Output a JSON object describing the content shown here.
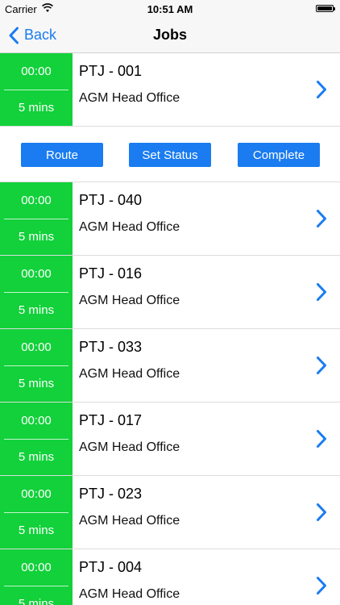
{
  "status_bar": {
    "carrier": "Carrier",
    "time": "10:51 AM"
  },
  "nav": {
    "back_label": "Back",
    "title": "Jobs"
  },
  "colors": {
    "accent": "#1a7cf0",
    "time_block": "#12d13a"
  },
  "actions": {
    "route": "Route",
    "set_status": "Set Status",
    "complete": "Complete"
  },
  "jobs": [
    {
      "time": "00:00",
      "duration": "5 mins",
      "id": "PTJ - 001",
      "location": "AGM Head Office"
    },
    {
      "time": "00:00",
      "duration": "5 mins",
      "id": "PTJ - 040",
      "location": "AGM Head Office"
    },
    {
      "time": "00:00",
      "duration": "5 mins",
      "id": "PTJ - 016",
      "location": "AGM Head Office"
    },
    {
      "time": "00:00",
      "duration": "5 mins",
      "id": "PTJ - 033",
      "location": "AGM Head Office"
    },
    {
      "time": "00:00",
      "duration": "5 mins",
      "id": "PTJ - 017",
      "location": "AGM Head Office"
    },
    {
      "time": "00:00",
      "duration": "5 mins",
      "id": "PTJ - 023",
      "location": "AGM Head Office"
    },
    {
      "time": "00:00",
      "duration": "5 mins",
      "id": "PTJ - 004",
      "location": "AGM Head Office"
    }
  ]
}
